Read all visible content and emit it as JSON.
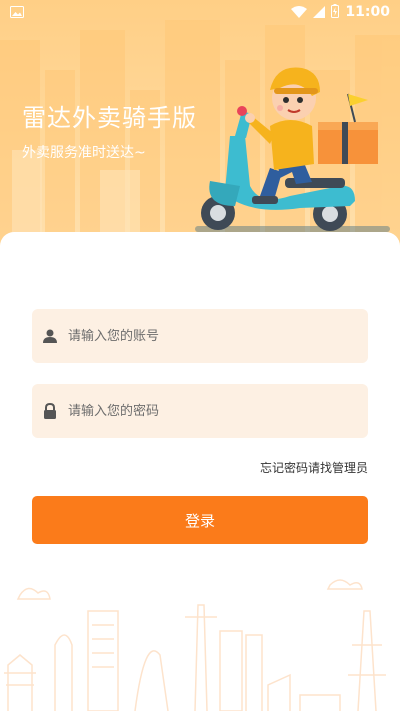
{
  "status_bar": {
    "time": "11:00",
    "icons": [
      "image-icon",
      "wifi-icon",
      "cellular-signal-icon",
      "battery-charging-icon"
    ]
  },
  "hero": {
    "title": "雷达外卖骑手版",
    "subtitle": "外卖服务准时送达~"
  },
  "login": {
    "account_placeholder": "请输入您的账号",
    "password_placeholder": "请输入您的密码",
    "forgot_text": "忘记密码请找管理员",
    "submit_label": "登录"
  },
  "colors": {
    "accent": "#fb7b1a",
    "hero_bg": "#ffd89a",
    "field_bg": "#fdf0e3"
  }
}
